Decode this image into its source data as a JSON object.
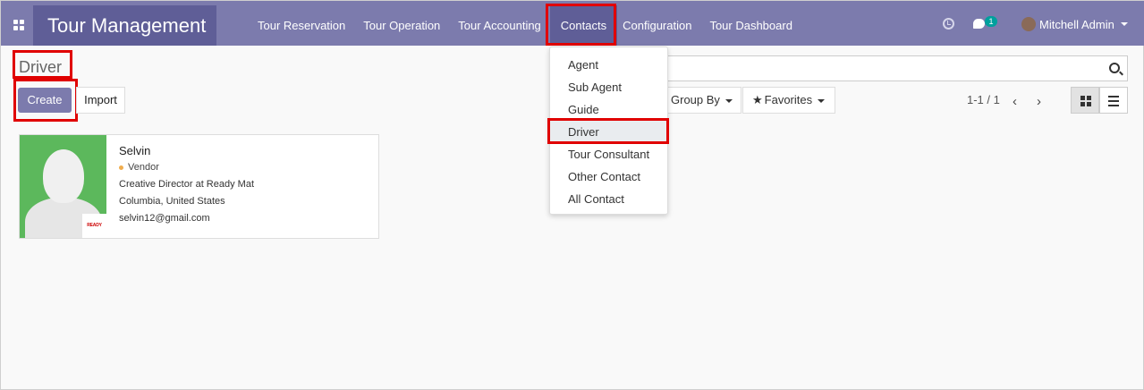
{
  "navbar": {
    "app_title": "Tour Management",
    "menu": [
      "Tour Reservation",
      "Tour Operation",
      "Tour Accounting",
      "Contacts",
      "Configuration",
      "Tour Dashboard"
    ],
    "active_menu": "Contacts",
    "chat_badge": "1",
    "user_name": "Mitchell Admin",
    "icons": [
      "apps-icon",
      "clock-icon",
      "chat-icon",
      "avatar"
    ]
  },
  "page": {
    "title": "Driver",
    "create_label": "Create",
    "import_label": "Import"
  },
  "search": {
    "value": "",
    "placeholder": ""
  },
  "filters": {
    "group_by_label": "Group By",
    "favorites_label": "Favorites"
  },
  "pager": {
    "text": "1-1 / 1"
  },
  "contacts_dropdown": {
    "items": [
      "Agent",
      "Sub Agent",
      "Guide",
      "Driver",
      "Tour Consultant",
      "Other Contact",
      "All Contact"
    ],
    "active_item": "Driver"
  },
  "card": {
    "name": "Selvin",
    "tag": "Vendor",
    "job": "Creative Director at Ready Mat",
    "location": "Columbia, United States",
    "email": "selvin12@gmail.com",
    "logo_text": "READY MAT"
  },
  "colors": {
    "navbar": "#7c7bad",
    "brand": "#5f5e97",
    "highlight": "#e00000",
    "tag_dot": "#f0ad4e",
    "image_bg": "#5cb85c"
  }
}
